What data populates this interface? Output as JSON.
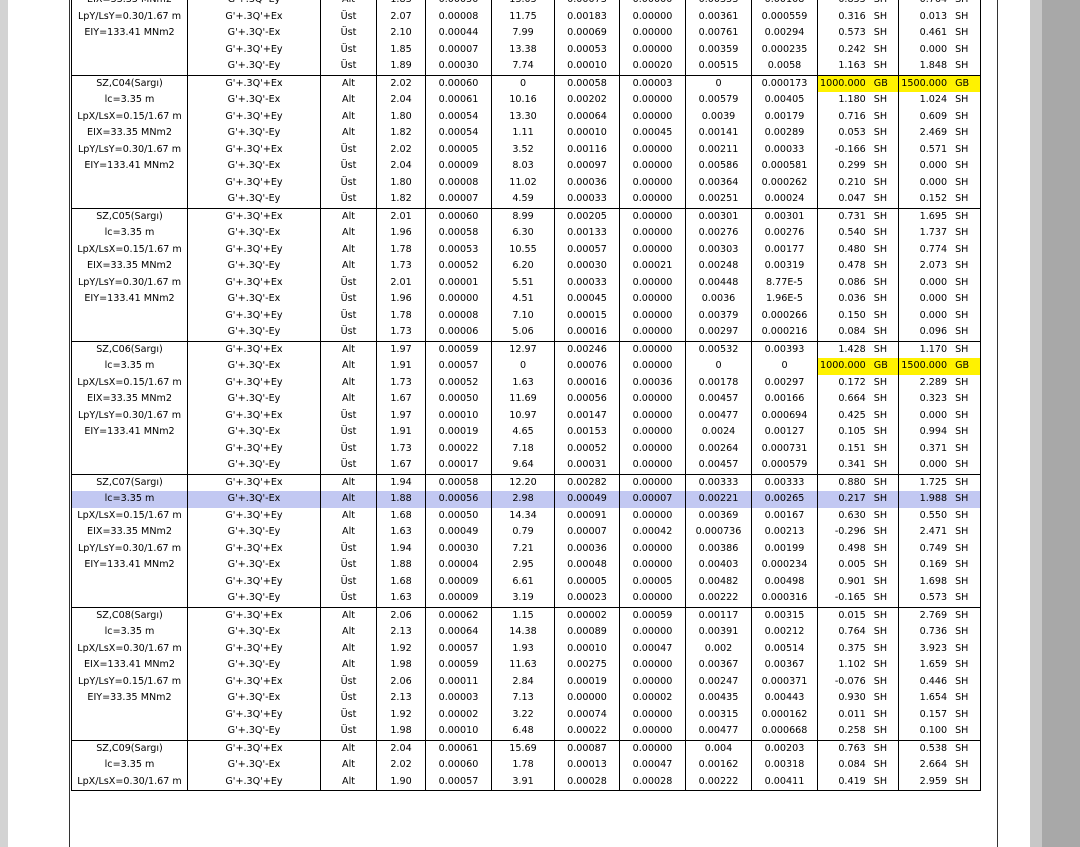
{
  "colors": {
    "highlight": "#fff200",
    "selected_row": "#c2c8f2",
    "app_background": "#ababab"
  },
  "rows": [
    {
      "label": "EIX=33.35 MNm2",
      "combo": "G'+.3Q'-Ey",
      "pos": "Alt",
      "v1": "1.83",
      "v2": "0.00050",
      "v3": "13.05",
      "v4": "0.00073",
      "v5": "0.00000",
      "v6": "0.00353",
      "v7": "0.00108",
      "v8": "0.855",
      "u8": "SH",
      "v9": "0.764",
      "u9": "SH"
    },
    {
      "label": "LpY/LsY=0.30/1.67 m",
      "combo": "G'+.3Q'+Ex",
      "pos": "Üst",
      "v1": "2.07",
      "v2": "0.00008",
      "v3": "11.75",
      "v4": "0.00183",
      "v5": "0.00000",
      "v6": "0.00361",
      "v7": "0.000559",
      "v8": "0.316",
      "u8": "SH",
      "v9": "0.013",
      "u9": "SH"
    },
    {
      "label": "EIY=133.41 MNm2",
      "combo": "G'+.3Q'-Ex",
      "pos": "Üst",
      "v1": "2.10",
      "v2": "0.00044",
      "v3": "7.99",
      "v4": "0.00069",
      "v5": "0.00000",
      "v6": "0.00761",
      "v7": "0.00294",
      "v8": "0.573",
      "u8": "SH",
      "v9": "0.461",
      "u9": "SH"
    },
    {
      "label": "",
      "combo": "G'+.3Q'+Ey",
      "pos": "Üst",
      "v1": "1.85",
      "v2": "0.00007",
      "v3": "13.38",
      "v4": "0.00053",
      "v5": "0.00000",
      "v6": "0.00359",
      "v7": "0.000235",
      "v8": "0.242",
      "u8": "SH",
      "v9": "0.000",
      "u9": "SH"
    },
    {
      "label": "",
      "combo": "G'+.3Q'-Ey",
      "pos": "Üst",
      "v1": "1.89",
      "v2": "0.00030",
      "v3": "7.74",
      "v4": "0.00010",
      "v5": "0.00020",
      "v6": "0.00515",
      "v7": "0.0058",
      "v8": "1.163",
      "u8": "SH",
      "v9": "1.848",
      "u9": "SH"
    },
    {
      "label": "SZ,C04(Sargı)",
      "combo": "G'+.3Q'+Ex",
      "pos": "Alt",
      "v1": "2.02",
      "v2": "0.00060",
      "v3": "0",
      "v4": "0.00058",
      "v5": "0.00003",
      "v6": "0",
      "v7": "0.000173",
      "v8": "1000.000",
      "u8": "GB",
      "v9": "1500.000",
      "u9": "GB"
    },
    {
      "label": "lc=3.35 m",
      "combo": "G'+.3Q'-Ex",
      "pos": "Alt",
      "v1": "2.04",
      "v2": "0.00061",
      "v3": "10.16",
      "v4": "0.00202",
      "v5": "0.00000",
      "v6": "0.00579",
      "v7": "0.00405",
      "v8": "1.180",
      "u8": "SH",
      "v9": "1.024",
      "u9": "SH"
    },
    {
      "label": "LpX/LsX=0.15/1.67 m",
      "combo": "G'+.3Q'+Ey",
      "pos": "Alt",
      "v1": "1.80",
      "v2": "0.00054",
      "v3": "13.30",
      "v4": "0.00064",
      "v5": "0.00000",
      "v6": "0.0039",
      "v7": "0.00179",
      "v8": "0.716",
      "u8": "SH",
      "v9": "0.609",
      "u9": "SH"
    },
    {
      "label": "EIX=33.35 MNm2",
      "combo": "G'+.3Q'-Ey",
      "pos": "Alt",
      "v1": "1.82",
      "v2": "0.00054",
      "v3": "1.11",
      "v4": "0.00010",
      "v5": "0.00045",
      "v6": "0.00141",
      "v7": "0.00289",
      "v8": "0.053",
      "u8": "SH",
      "v9": "2.469",
      "u9": "SH"
    },
    {
      "label": "LpY/LsY=0.30/1.67 m",
      "combo": "G'+.3Q'+Ex",
      "pos": "Üst",
      "v1": "2.02",
      "v2": "0.00005",
      "v3": "3.52",
      "v4": "0.00116",
      "v5": "0.00000",
      "v6": "0.00211",
      "v7": "0.00033",
      "v8": "-0.166",
      "u8": "SH",
      "v9": "0.571",
      "u9": "SH"
    },
    {
      "label": "EIY=133.41 MNm2",
      "combo": "G'+.3Q'-Ex",
      "pos": "Üst",
      "v1": "2.04",
      "v2": "0.00009",
      "v3": "8.03",
      "v4": "0.00097",
      "v5": "0.00000",
      "v6": "0.00586",
      "v7": "0.000581",
      "v8": "0.299",
      "u8": "SH",
      "v9": "0.000",
      "u9": "SH"
    },
    {
      "label": "",
      "combo": "G'+.3Q'+Ey",
      "pos": "Üst",
      "v1": "1.80",
      "v2": "0.00008",
      "v3": "11.02",
      "v4": "0.00036",
      "v5": "0.00000",
      "v6": "0.00364",
      "v7": "0.000262",
      "v8": "0.210",
      "u8": "SH",
      "v9": "0.000",
      "u9": "SH"
    },
    {
      "label": "",
      "combo": "G'+.3Q'-Ey",
      "pos": "Üst",
      "v1": "1.82",
      "v2": "0.00007",
      "v3": "4.59",
      "v4": "0.00033",
      "v5": "0.00000",
      "v6": "0.00251",
      "v7": "0.00024",
      "v8": "0.047",
      "u8": "SH",
      "v9": "0.152",
      "u9": "SH"
    },
    {
      "label": "SZ,C05(Sargı)",
      "combo": "G'+.3Q'+Ex",
      "pos": "Alt",
      "v1": "2.01",
      "v2": "0.00060",
      "v3": "8.99",
      "v4": "0.00205",
      "v5": "0.00000",
      "v6": "0.00301",
      "v7": "0.00301",
      "v8": "0.731",
      "u8": "SH",
      "v9": "1.695",
      "u9": "SH"
    },
    {
      "label": "lc=3.35 m",
      "combo": "G'+.3Q'-Ex",
      "pos": "Alt",
      "v1": "1.96",
      "v2": "0.00058",
      "v3": "6.30",
      "v4": "0.00133",
      "v5": "0.00000",
      "v6": "0.00276",
      "v7": "0.00276",
      "v8": "0.540",
      "u8": "SH",
      "v9": "1.737",
      "u9": "SH"
    },
    {
      "label": "LpX/LsX=0.15/1.67 m",
      "combo": "G'+.3Q'+Ey",
      "pos": "Alt",
      "v1": "1.78",
      "v2": "0.00053",
      "v3": "10.55",
      "v4": "0.00057",
      "v5": "0.00000",
      "v6": "0.00303",
      "v7": "0.00177",
      "v8": "0.480",
      "u8": "SH",
      "v9": "0.774",
      "u9": "SH"
    },
    {
      "label": "EIX=33.35 MNm2",
      "combo": "G'+.3Q'-Ey",
      "pos": "Alt",
      "v1": "1.73",
      "v2": "0.00052",
      "v3": "6.20",
      "v4": "0.00030",
      "v5": "0.00021",
      "v6": "0.00248",
      "v7": "0.00319",
      "v8": "0.478",
      "u8": "SH",
      "v9": "2.073",
      "u9": "SH"
    },
    {
      "label": "LpY/LsY=0.30/1.67 m",
      "combo": "G'+.3Q'+Ex",
      "pos": "Üst",
      "v1": "2.01",
      "v2": "0.00001",
      "v3": "5.51",
      "v4": "0.00033",
      "v5": "0.00000",
      "v6": "0.00448",
      "v7": "8.77E-5",
      "v8": "0.086",
      "u8": "SH",
      "v9": "0.000",
      "u9": "SH"
    },
    {
      "label": "EIY=133.41 MNm2",
      "combo": "G'+.3Q'-Ex",
      "pos": "Üst",
      "v1": "1.96",
      "v2": "0.00000",
      "v3": "4.51",
      "v4": "0.00045",
      "v5": "0.00000",
      "v6": "0.0036",
      "v7": "1.96E-5",
      "v8": "0.036",
      "u8": "SH",
      "v9": "0.000",
      "u9": "SH"
    },
    {
      "label": "",
      "combo": "G'+.3Q'+Ey",
      "pos": "Üst",
      "v1": "1.78",
      "v2": "0.00008",
      "v3": "7.10",
      "v4": "0.00015",
      "v5": "0.00000",
      "v6": "0.00379",
      "v7": "0.000266",
      "v8": "0.150",
      "u8": "SH",
      "v9": "0.000",
      "u9": "SH"
    },
    {
      "label": "",
      "combo": "G'+.3Q'-Ey",
      "pos": "Üst",
      "v1": "1.73",
      "v2": "0.00006",
      "v3": "5.06",
      "v4": "0.00016",
      "v5": "0.00000",
      "v6": "0.00297",
      "v7": "0.000216",
      "v8": "0.084",
      "u8": "SH",
      "v9": "0.096",
      "u9": "SH"
    },
    {
      "label": "SZ,C06(Sargı)",
      "combo": "G'+.3Q'+Ex",
      "pos": "Alt",
      "v1": "1.97",
      "v2": "0.00059",
      "v3": "12.97",
      "v4": "0.00246",
      "v5": "0.00000",
      "v6": "0.00532",
      "v7": "0.00393",
      "v8": "1.428",
      "u8": "SH",
      "v9": "1.170",
      "u9": "SH"
    },
    {
      "label": "lc=3.35 m",
      "combo": "G'+.3Q'-Ex",
      "pos": "Alt",
      "v1": "1.91",
      "v2": "0.00057",
      "v3": "0",
      "v4": "0.00076",
      "v5": "0.00000",
      "v6": "0",
      "v7": "0",
      "v8": "1000.000",
      "u8": "GB",
      "v9": "1500.000",
      "u9": "GB"
    },
    {
      "label": "LpX/LsX=0.15/1.67 m",
      "combo": "G'+.3Q'+Ey",
      "pos": "Alt",
      "v1": "1.73",
      "v2": "0.00052",
      "v3": "1.63",
      "v4": "0.00016",
      "v5": "0.00036",
      "v6": "0.00178",
      "v7": "0.00297",
      "v8": "0.172",
      "u8": "SH",
      "v9": "2.289",
      "u9": "SH"
    },
    {
      "label": "EIX=33.35 MNm2",
      "combo": "G'+.3Q'-Ey",
      "pos": "Alt",
      "v1": "1.67",
      "v2": "0.00050",
      "v3": "11.69",
      "v4": "0.00056",
      "v5": "0.00000",
      "v6": "0.00457",
      "v7": "0.00166",
      "v8": "0.664",
      "u8": "SH",
      "v9": "0.323",
      "u9": "SH"
    },
    {
      "label": "LpY/LsY=0.30/1.67 m",
      "combo": "G'+.3Q'+Ex",
      "pos": "Üst",
      "v1": "1.97",
      "v2": "0.00010",
      "v3": "10.97",
      "v4": "0.00147",
      "v5": "0.00000",
      "v6": "0.00477",
      "v7": "0.000694",
      "v8": "0.425",
      "u8": "SH",
      "v9": "0.000",
      "u9": "SH"
    },
    {
      "label": "EIY=133.41 MNm2",
      "combo": "G'+.3Q'-Ex",
      "pos": "Üst",
      "v1": "1.91",
      "v2": "0.00019",
      "v3": "4.65",
      "v4": "0.00153",
      "v5": "0.00000",
      "v6": "0.0024",
      "v7": "0.00127",
      "v8": "0.105",
      "u8": "SH",
      "v9": "0.994",
      "u9": "SH"
    },
    {
      "label": "",
      "combo": "G'+.3Q'+Ey",
      "pos": "Üst",
      "v1": "1.73",
      "v2": "0.00022",
      "v3": "7.18",
      "v4": "0.00052",
      "v5": "0.00000",
      "v6": "0.00264",
      "v7": "0.000731",
      "v8": "0.151",
      "u8": "SH",
      "v9": "0.371",
      "u9": "SH"
    },
    {
      "label": "",
      "combo": "G'+.3Q'-Ey",
      "pos": "Üst",
      "v1": "1.67",
      "v2": "0.00017",
      "v3": "9.64",
      "v4": "0.00031",
      "v5": "0.00000",
      "v6": "0.00457",
      "v7": "0.000579",
      "v8": "0.341",
      "u8": "SH",
      "v9": "0.000",
      "u9": "SH"
    },
    {
      "label": "SZ,C07(Sargı)",
      "combo": "G'+.3Q'+Ex",
      "pos": "Alt",
      "v1": "1.94",
      "v2": "0.00058",
      "v3": "12.20",
      "v4": "0.00282",
      "v5": "0.00000",
      "v6": "0.00333",
      "v7": "0.00333",
      "v8": "0.880",
      "u8": "SH",
      "v9": "1.725",
      "u9": "SH"
    },
    {
      "label": "lc=3.35 m",
      "combo": "G'+.3Q'-Ex",
      "pos": "Alt",
      "v1": "1.88",
      "v2": "0.00056",
      "v3": "2.98",
      "v4": "0.00049",
      "v5": "0.00007",
      "v6": "0.00221",
      "v7": "0.00265",
      "v8": "0.217",
      "u8": "SH",
      "v9": "1.988",
      "u9": "SH"
    },
    {
      "label": "LpX/LsX=0.15/1.67 m",
      "combo": "G'+.3Q'+Ey",
      "pos": "Alt",
      "v1": "1.68",
      "v2": "0.00050",
      "v3": "14.34",
      "v4": "0.00091",
      "v5": "0.00000",
      "v6": "0.00369",
      "v7": "0.00167",
      "v8": "0.630",
      "u8": "SH",
      "v9": "0.550",
      "u9": "SH"
    },
    {
      "label": "EIX=33.35 MNm2",
      "combo": "G'+.3Q'-Ey",
      "pos": "Alt",
      "v1": "1.63",
      "v2": "0.00049",
      "v3": "0.79",
      "v4": "0.00007",
      "v5": "0.00042",
      "v6": "0.000736",
      "v7": "0.00213",
      "v8": "-0.296",
      "u8": "SH",
      "v9": "2.471",
      "u9": "SH"
    },
    {
      "label": "LpY/LsY=0.30/1.67 m",
      "combo": "G'+.3Q'+Ex",
      "pos": "Üst",
      "v1": "1.94",
      "v2": "0.00030",
      "v3": "7.21",
      "v4": "0.00036",
      "v5": "0.00000",
      "v6": "0.00386",
      "v7": "0.00199",
      "v8": "0.498",
      "u8": "SH",
      "v9": "0.749",
      "u9": "SH"
    },
    {
      "label": "EIY=133.41 MNm2",
      "combo": "G'+.3Q'-Ex",
      "pos": "Üst",
      "v1": "1.88",
      "v2": "0.00004",
      "v3": "2.95",
      "v4": "0.00048",
      "v5": "0.00000",
      "v6": "0.00403",
      "v7": "0.000234",
      "v8": "0.005",
      "u8": "SH",
      "v9": "0.169",
      "u9": "SH"
    },
    {
      "label": "",
      "combo": "G'+.3Q'+Ey",
      "pos": "Üst",
      "v1": "1.68",
      "v2": "0.00009",
      "v3": "6.61",
      "v4": "0.00005",
      "v5": "0.00005",
      "v6": "0.00482",
      "v7": "0.00498",
      "v8": "0.901",
      "u8": "SH",
      "v9": "1.698",
      "u9": "SH"
    },
    {
      "label": "",
      "combo": "G'+.3Q'-Ey",
      "pos": "Üst",
      "v1": "1.63",
      "v2": "0.00009",
      "v3": "3.19",
      "v4": "0.00023",
      "v5": "0.00000",
      "v6": "0.00222",
      "v7": "0.000316",
      "v8": "-0.165",
      "u8": "SH",
      "v9": "0.573",
      "u9": "SH"
    },
    {
      "label": "SZ,C08(Sargı)",
      "combo": "G'+.3Q'+Ex",
      "pos": "Alt",
      "v1": "2.06",
      "v2": "0.00062",
      "v3": "1.15",
      "v4": "0.00002",
      "v5": "0.00059",
      "v6": "0.00117",
      "v7": "0.00315",
      "v8": "0.015",
      "u8": "SH",
      "v9": "2.769",
      "u9": "SH"
    },
    {
      "label": "lc=3.35 m",
      "combo": "G'+.3Q'-Ex",
      "pos": "Alt",
      "v1": "2.13",
      "v2": "0.00064",
      "v3": "14.38",
      "v4": "0.00089",
      "v5": "0.00000",
      "v6": "0.00391",
      "v7": "0.00212",
      "v8": "0.764",
      "u8": "SH",
      "v9": "0.736",
      "u9": "SH"
    },
    {
      "label": "LpX/LsX=0.30/1.67 m",
      "combo": "G'+.3Q'+Ey",
      "pos": "Alt",
      "v1": "1.92",
      "v2": "0.00057",
      "v3": "1.93",
      "v4": "0.00010",
      "v5": "0.00047",
      "v6": "0.002",
      "v7": "0.00514",
      "v8": "0.375",
      "u8": "SH",
      "v9": "3.923",
      "u9": "SH"
    },
    {
      "label": "EIX=133.41 MNm2",
      "combo": "G'+.3Q'-Ey",
      "pos": "Alt",
      "v1": "1.98",
      "v2": "0.00059",
      "v3": "11.63",
      "v4": "0.00275",
      "v5": "0.00000",
      "v6": "0.00367",
      "v7": "0.00367",
      "v8": "1.102",
      "u8": "SH",
      "v9": "1.659",
      "u9": "SH"
    },
    {
      "label": "LpY/LsY=0.15/1.67 m",
      "combo": "G'+.3Q'+Ex",
      "pos": "Üst",
      "v1": "2.06",
      "v2": "0.00011",
      "v3": "2.84",
      "v4": "0.00019",
      "v5": "0.00000",
      "v6": "0.00247",
      "v7": "0.000371",
      "v8": "-0.076",
      "u8": "SH",
      "v9": "0.446",
      "u9": "SH"
    },
    {
      "label": "EIY=33.35 MNm2",
      "combo": "G'+.3Q'-Ex",
      "pos": "Üst",
      "v1": "2.13",
      "v2": "0.00003",
      "v3": "7.13",
      "v4": "0.00000",
      "v5": "0.00002",
      "v6": "0.00435",
      "v7": "0.00443",
      "v8": "0.930",
      "u8": "SH",
      "v9": "1.654",
      "u9": "SH"
    },
    {
      "label": "",
      "combo": "G'+.3Q'+Ey",
      "pos": "Üst",
      "v1": "1.92",
      "v2": "0.00002",
      "v3": "3.22",
      "v4": "0.00074",
      "v5": "0.00000",
      "v6": "0.00315",
      "v7": "0.000162",
      "v8": "0.011",
      "u8": "SH",
      "v9": "0.157",
      "u9": "SH"
    },
    {
      "label": "",
      "combo": "G'+.3Q'-Ey",
      "pos": "Üst",
      "v1": "1.98",
      "v2": "0.00010",
      "v3": "6.48",
      "v4": "0.00022",
      "v5": "0.00000",
      "v6": "0.00477",
      "v7": "0.000668",
      "v8": "0.258",
      "u8": "SH",
      "v9": "0.100",
      "u9": "SH"
    },
    {
      "label": "SZ,C09(Sargı)",
      "combo": "G'+.3Q'+Ex",
      "pos": "Alt",
      "v1": "2.04",
      "v2": "0.00061",
      "v3": "15.69",
      "v4": "0.00087",
      "v5": "0.00000",
      "v6": "0.004",
      "v7": "0.00203",
      "v8": "0.763",
      "u8": "SH",
      "v9": "0.538",
      "u9": "SH"
    },
    {
      "label": "lc=3.35 m",
      "combo": "G'+.3Q'-Ex",
      "pos": "Alt",
      "v1": "2.02",
      "v2": "0.00060",
      "v3": "1.78",
      "v4": "0.00013",
      "v5": "0.00047",
      "v6": "0.00162",
      "v7": "0.00318",
      "v8": "0.084",
      "u8": "SH",
      "v9": "2.664",
      "u9": "SH"
    },
    {
      "label": "LpX/LsX=0.30/1.67 m",
      "combo": "G'+.3Q'+Ey",
      "pos": "Alt",
      "v1": "1.90",
      "v2": "0.00057",
      "v3": "3.91",
      "v4": "0.00028",
      "v5": "0.00028",
      "v6": "0.00222",
      "v7": "0.00411",
      "v8": "0.419",
      "u8": "SH",
      "v9": "2.959",
      "u9": "SH"
    }
  ]
}
